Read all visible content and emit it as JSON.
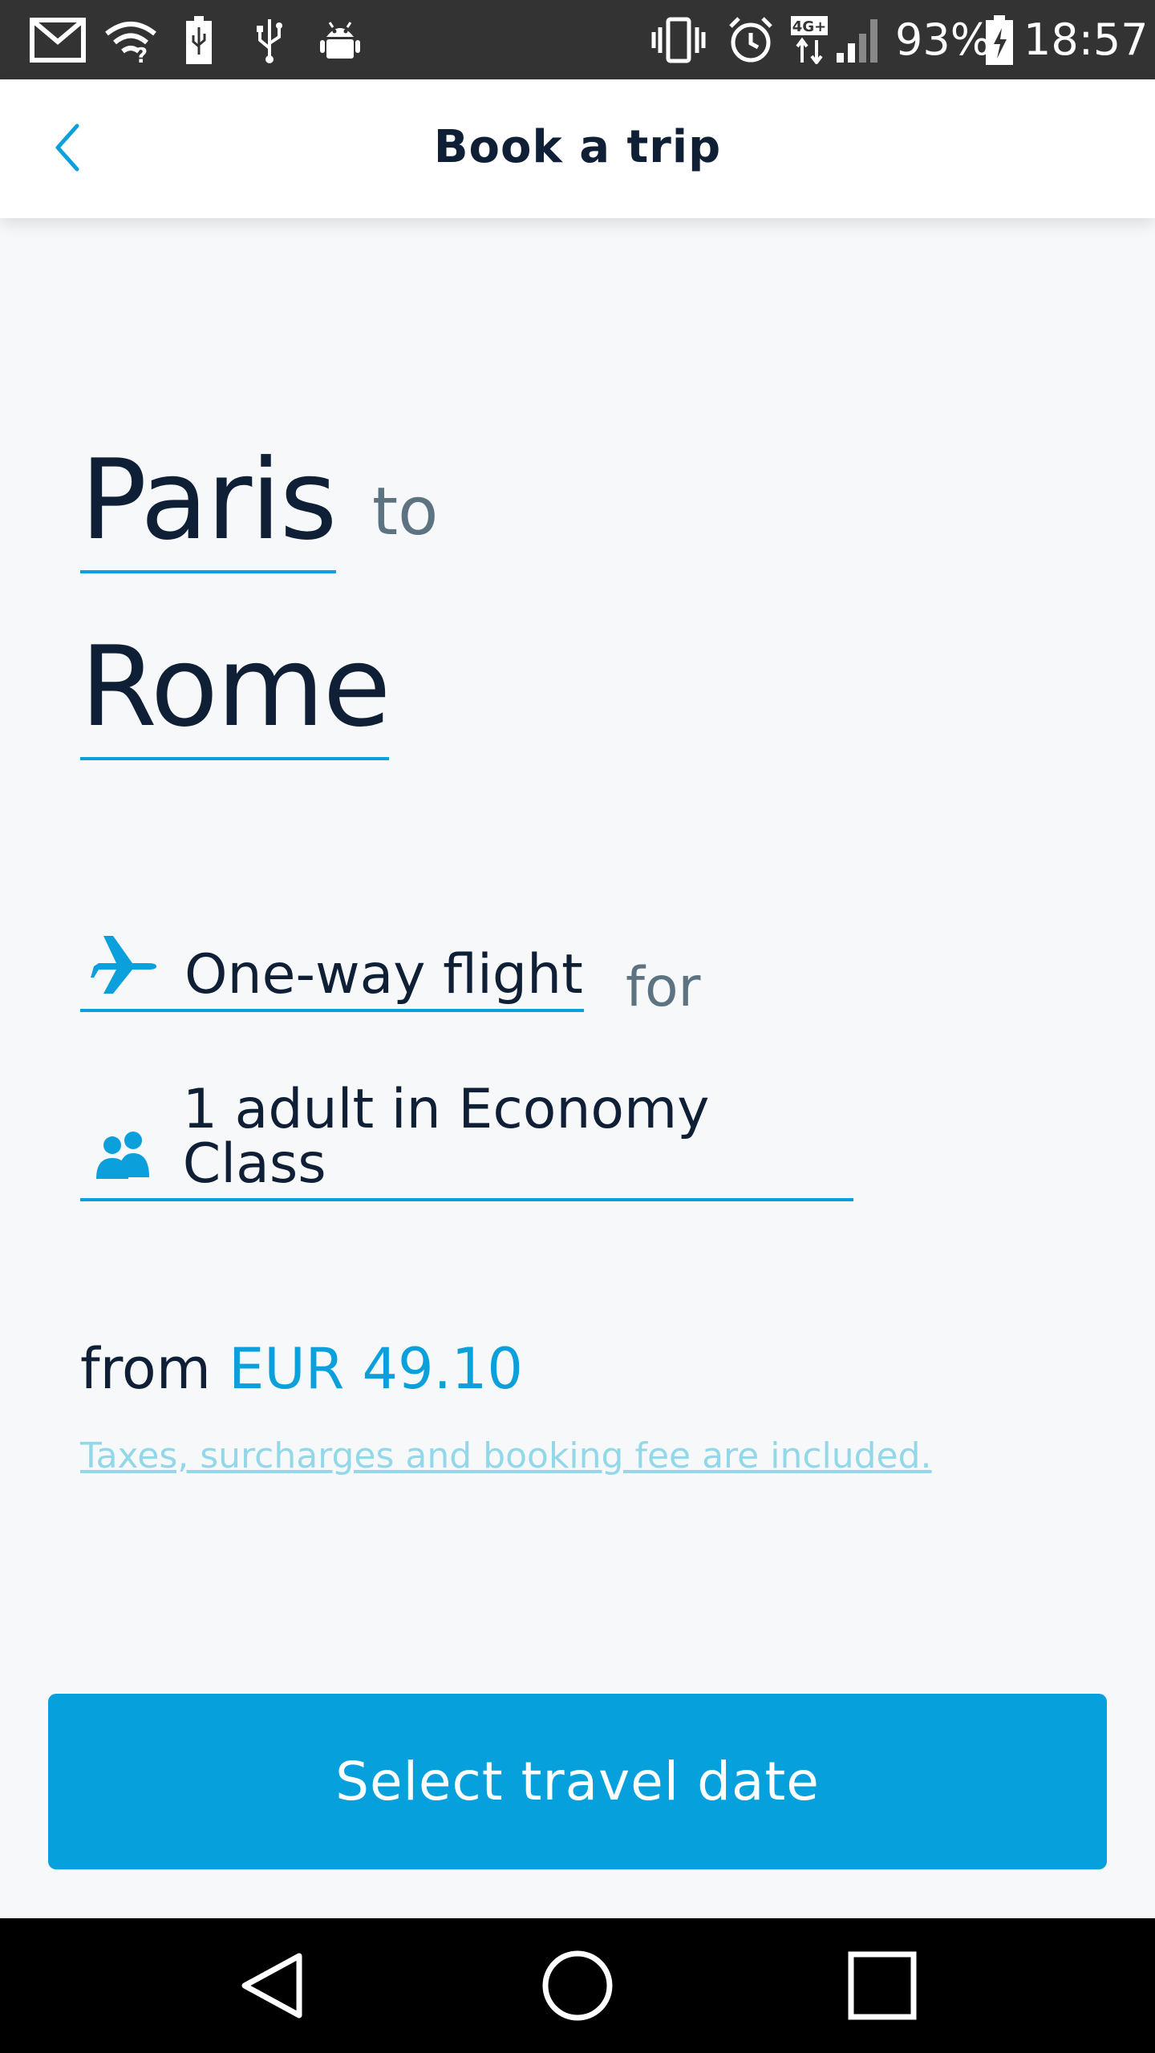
{
  "status_bar": {
    "icons": [
      "gmail-icon",
      "wifi-question-icon",
      "battery-usb-icon",
      "usb-icon",
      "android-icon",
      "vibrate-icon",
      "alarm-icon",
      "network-4g-icon",
      "signal-icon",
      "battery-charging-icon"
    ],
    "network_label": "4G+",
    "battery_percent": "93%",
    "time": "18:57"
  },
  "app_bar": {
    "title": "Book a trip",
    "back_icon": "chevron-left-icon"
  },
  "trip": {
    "origin": "Paris",
    "to_word": "to",
    "destination": "Rome",
    "flight_type": "One-way flight",
    "flight_type_icon": "airplane-icon",
    "for_word": "for",
    "passengers": "1 adult in Economy Class",
    "passengers_icon": "people-icon"
  },
  "pricing": {
    "from_word": "from",
    "price": "EUR 49.10",
    "fee_note": "Taxes, surcharges and booking fee are included."
  },
  "cta": {
    "label": "Select travel date"
  },
  "nav_bar": {
    "icons": [
      "back-triangle-icon",
      "home-circle-icon",
      "recents-square-icon"
    ]
  },
  "colors": {
    "accent": "#06a0dc",
    "text_dark": "#0f1f36",
    "text_muted": "#5d7382",
    "background": "#f6f8fa"
  }
}
